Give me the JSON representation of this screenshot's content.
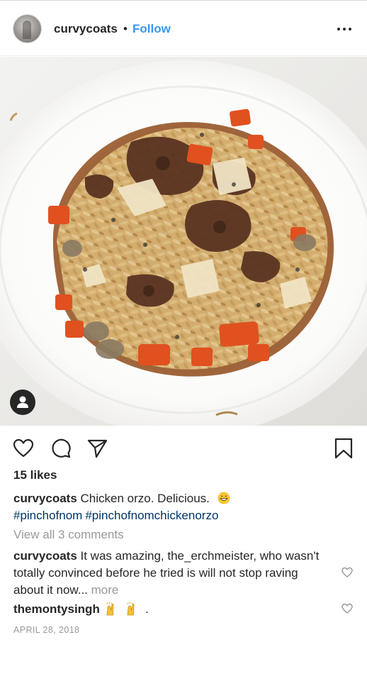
{
  "post": {
    "username": "curvycoats",
    "separator": "•",
    "follow_label": "Follow",
    "likes": "15 likes",
    "caption": {
      "username": "curvycoats",
      "text": "Chicken orzo. Delicious.",
      "emoji": "grinning-face-emoji",
      "hashtags": [
        "#pinchofnom",
        "#pinchofnomchickenorzo"
      ]
    },
    "view_all_comments": "View all 3 comments",
    "comments": [
      {
        "username": "curvycoats",
        "lines": [
          "It was amazing, the_erchmeister, who wasn't",
          "totally convinced before he tried is will not stop raving",
          "about it now..."
        ],
        "more_label": "more"
      },
      {
        "username": "themontysingh",
        "emoji": "raising-hands-emoji",
        "trailing": "."
      }
    ],
    "date": "APRIL 28, 2018",
    "icons": {
      "options": "more-options-icon",
      "user_tag": "user-tag-icon",
      "like": "heart-icon",
      "comment": "comment-icon",
      "share": "share-icon",
      "save": "bookmark-icon",
      "comment_like": "heart-icon"
    }
  }
}
